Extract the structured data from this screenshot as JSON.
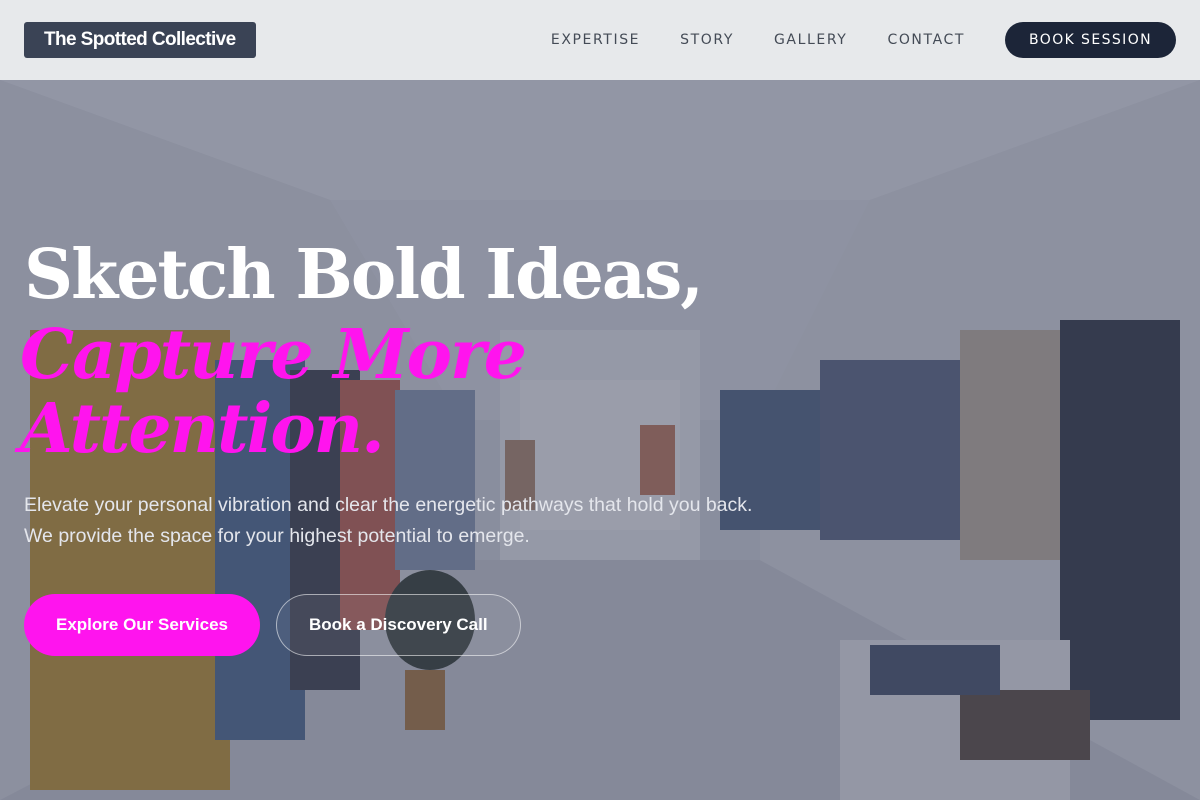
{
  "header": {
    "brand": "The Spotted Collective",
    "nav": [
      {
        "label": "EXPERTISE"
      },
      {
        "label": "STORY"
      },
      {
        "label": "GALLERY"
      },
      {
        "label": "CONTACT"
      }
    ],
    "cta_label": "BOOK SESSION"
  },
  "hero": {
    "headline_line1": "Sketch Bold Ideas,",
    "headline_line2": "Capture More",
    "headline_line3": "Attention.",
    "subtext": "Elevate your personal vibration and clear the energetic pathways that hold you back. We provide the space for your highest potential to emerge.",
    "primary_button": "Explore Our Services",
    "secondary_button": "Book a Discovery Call",
    "background_image": "clothing-store-interior"
  },
  "colors": {
    "accent": "#ff14ee",
    "header_bg": "#ebecee",
    "logo_bg": "#3a4355",
    "cta_bg": "#1c2538"
  }
}
